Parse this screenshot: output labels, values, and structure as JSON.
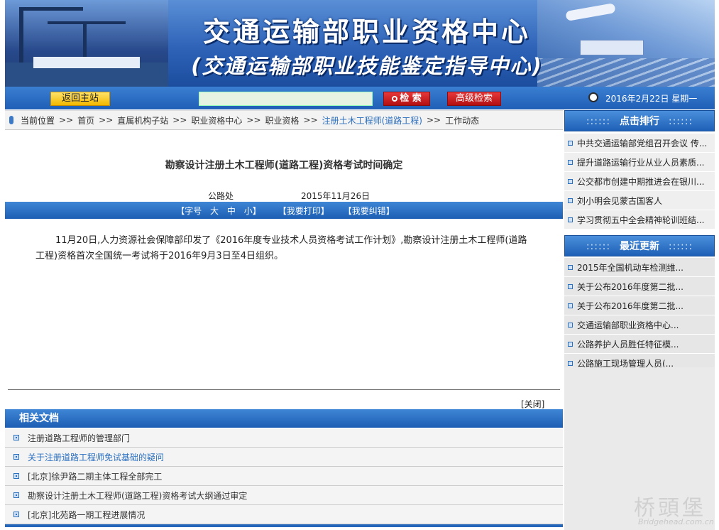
{
  "banner": {
    "title": "交通运输部职业资格中心",
    "subtitle": "(交通运输部职业技能鉴定指导中心)"
  },
  "nav": {
    "home": "返回主站",
    "search_value": "",
    "search": "检 索",
    "advanced": "高级检索",
    "date": "2016年2月22日 星期一"
  },
  "breadcrumb": {
    "label": "当前位置",
    "sep": ">>",
    "items": [
      "首页",
      "直属机构子站",
      "职业资格中心",
      "职业资格",
      "注册土木工程师(道路工程)",
      "工作动态"
    ]
  },
  "article": {
    "title": "勘察设计注册土木工程师(道路工程)资格考试时间确定",
    "source": "公路处",
    "date": "2015年11月26日",
    "tool_fontsize": "【字号",
    "tool_large": "大",
    "tool_medium": "中",
    "tool_small": "小】",
    "tool_print": "【我要打印】",
    "tool_correct": "【我要纠错】",
    "body": "11月20日,人力资源社会保障部印发了《2016年度专业技术人员资格考试工作计划》,勘察设计注册土木工程师(道路工程)资格首次全国统一考试将于2016年9月3日至4日组织。",
    "close": "[关闭]"
  },
  "related": {
    "title": "相关文档",
    "items": [
      "注册道路工程师的管理部门",
      "关于注册道路工程师免试基础的疑问",
      "[北京]徐尹路二期主体工程全部完工",
      "勘察设计注册土木工程师(道路工程)资格考试大纲通过审定",
      "[北京]北苑路一期工程进展情况"
    ]
  },
  "sidebar": {
    "ranking_title": "点击排行",
    "ranking_dots": "::::::",
    "ranking": [
      "中共交通运输部党组召开会议 传...",
      "提升道路运输行业从业人员素质...",
      "公交都市创建中期推进会在银川...",
      "刘小明会见蒙古国客人",
      "学习贯彻五中全会精神轮训班结..."
    ],
    "recent_title": "最近更新",
    "recent": [
      "2015年全国机动车检测维...",
      "关于公布2016年度第二批...",
      "关于公布2016年度第二批...",
      "交通运输部职业资格中心...",
      "公路养护人员胜任特征模...",
      "公路施工现场管理人员(..."
    ]
  },
  "watermark": {
    "cn": "桥頭堡",
    "url": "Bridgehead.com.cn"
  },
  "colors": {
    "primary_blue": "#1f5fb5",
    "home_button": "#f3b800",
    "search_red": "#c81a1c",
    "link_blue": "#2b6fbf"
  }
}
